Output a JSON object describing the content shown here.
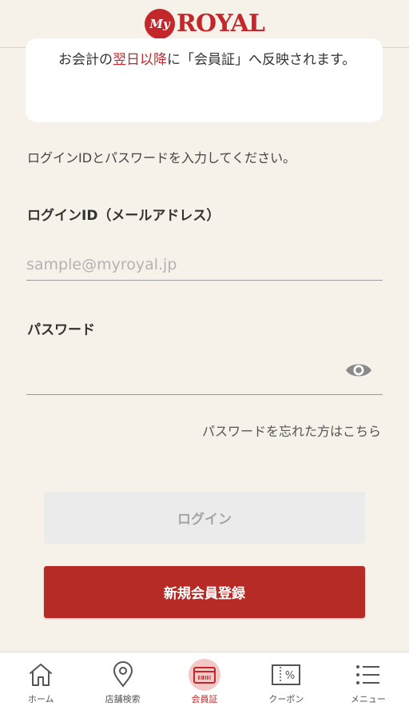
{
  "header": {
    "logo_badge": "My",
    "logo_text": "ROYAL"
  },
  "notice": {
    "prefix": "お会計の",
    "highlight": "翌日以降",
    "suffix": "に「会員証」へ反映されます。"
  },
  "instruction": "ログインIDとパスワードを入力してください。",
  "login_id": {
    "label": "ログインID（メールアドレス）",
    "placeholder": "sample@myroyal.jp",
    "value": ""
  },
  "password": {
    "label": "パスワード",
    "value": ""
  },
  "forgot_link": "パスワードを忘れた方はこちら",
  "buttons": {
    "login": "ログイン",
    "register": "新規会員登録"
  },
  "tabbar": {
    "items": [
      {
        "label": "ホーム",
        "icon": "home-icon"
      },
      {
        "label": "店舗検索",
        "icon": "location-pin-icon"
      },
      {
        "label": "会員証",
        "icon": "member-card-icon",
        "active": true
      },
      {
        "label": "クーポン",
        "icon": "coupon-icon"
      },
      {
        "label": "メニュー",
        "icon": "menu-list-icon"
      }
    ]
  },
  "colors": {
    "brand_red": "#c3272b",
    "background": "#f6f2ea"
  }
}
